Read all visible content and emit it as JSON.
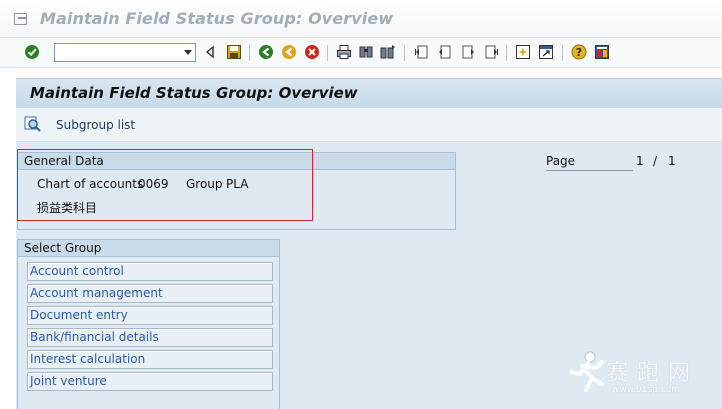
{
  "window": {
    "title": "Maintain Field Status Group: Overview"
  },
  "toolbar": {
    "command_field": {
      "value": "",
      "placeholder": ""
    },
    "icons": [
      "enter-icon",
      "back-icon",
      "save-icon",
      "green-back-icon",
      "exit-icon",
      "cancel-icon",
      "print-icon",
      "find-icon",
      "find-next-icon",
      "first-page-icon",
      "previous-page-icon",
      "next-page-icon",
      "last-page-icon",
      "new-session-icon",
      "shortcut-icon",
      "help-icon",
      "customize-layout-icon"
    ]
  },
  "screen": {
    "title": "Maintain Field Status Group: Overview"
  },
  "app_toolbar": {
    "subgroup_list_label": "Subgroup list"
  },
  "general_data": {
    "heading": "General Data",
    "chart_of_accounts_label": "Chart of accounts",
    "chart_of_accounts_value": "0069",
    "group_label": "Group",
    "group_value": "PLA",
    "group_description": "损益类科目"
  },
  "page_info": {
    "label": "Page",
    "current": "1",
    "separator": "/",
    "total": "1"
  },
  "select_group": {
    "heading": "Select Group",
    "items": [
      "Account control",
      "Account management",
      "Document entry",
      "Bank/financial details",
      "Interest calculation",
      "Joint venture"
    ]
  },
  "watermark": {
    "text": "赛跑网",
    "url": "www.91sp.com"
  },
  "colors": {
    "title_text": "#a3adb8",
    "screen_title_bg": "#c7d9e8",
    "content_bg": "#dfe9f2",
    "link_text": "#2d5aa8",
    "highlight_frame": "#d9232e"
  }
}
